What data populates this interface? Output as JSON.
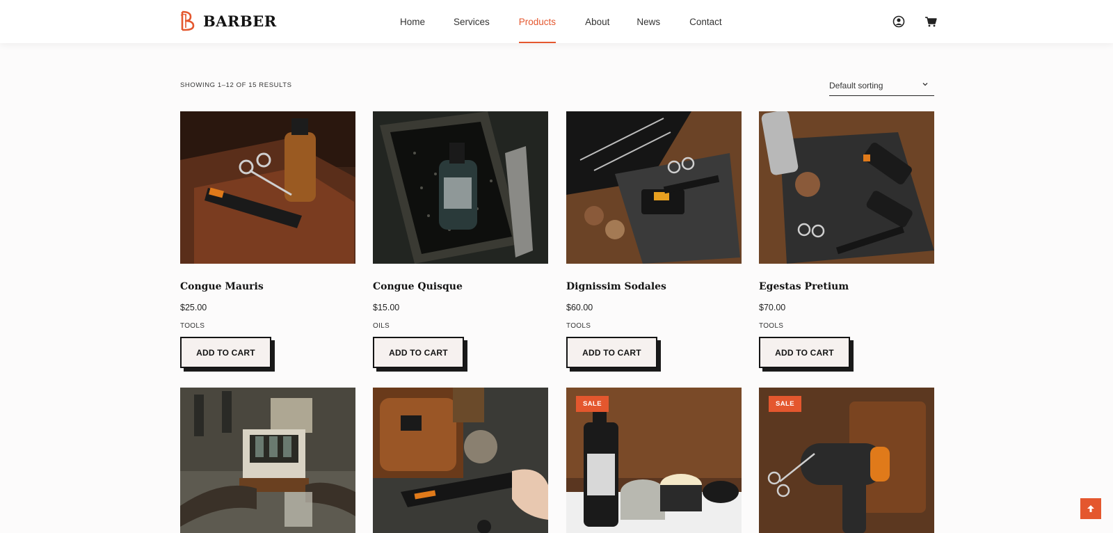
{
  "brand": {
    "name": "BARBER",
    "accent": "#e4572e"
  },
  "nav": [
    {
      "label": "Home",
      "active": false
    },
    {
      "label": "Services",
      "active": false
    },
    {
      "label": "Products",
      "active": true
    },
    {
      "label": "About",
      "active": false
    },
    {
      "label": "News",
      "active": false
    },
    {
      "label": "Contact",
      "active": false
    }
  ],
  "header_icons": [
    "user-icon",
    "cart-icon"
  ],
  "shop": {
    "result_count": "SHOWING 1–12 OF 15 RESULTS",
    "sort_selected": "Default sorting"
  },
  "products": [
    {
      "title": "Congue Mauris",
      "price": "$25.00",
      "category": "TOOLS",
      "button": "ADD TO CART"
    },
    {
      "title": "Congue Quisque",
      "price": "$15.00",
      "category": "OILS",
      "button": "ADD TO CART"
    },
    {
      "title": "Dignissim Sodales",
      "price": "$60.00",
      "category": "TOOLS",
      "button": "ADD TO CART"
    },
    {
      "title": "Egestas Pretium",
      "price": "$70.00",
      "category": "TOOLS",
      "button": "ADD TO CART"
    },
    {
      "badge": ""
    },
    {
      "badge": ""
    },
    {
      "badge": "SALE"
    },
    {
      "badge": "SALE"
    }
  ],
  "scroll_top_icon": "arrow-up-icon"
}
